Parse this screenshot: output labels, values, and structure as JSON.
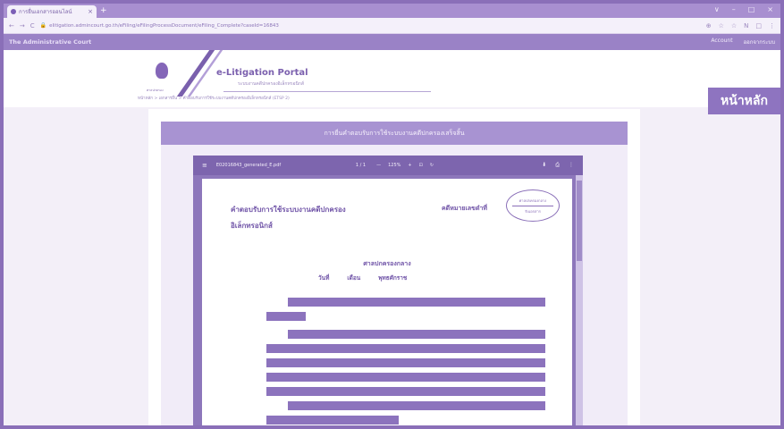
{
  "browser": {
    "tab_title": "การยื่นเอกสารออนไลน์",
    "tab_close": "×",
    "new_tab": "+",
    "window_controls": [
      "∨",
      "–",
      "□",
      "×"
    ],
    "nav": [
      "←",
      "→",
      "C"
    ],
    "url": "elitigation.admincourt.go.th/eFiling/eFilingProcessDocument/eFiling_Complete?caseId=16843",
    "tools": [
      "⊕",
      "☆",
      "☆",
      "N",
      "□",
      "⋮"
    ]
  },
  "site": {
    "brand": "The Administrative Court",
    "links": [
      "Account",
      "ออกจากระบบ"
    ],
    "emblem_label": "ศาลปกครอง",
    "portal_title": "e-Litigation Portal",
    "portal_subtitle": "ระบบงานคดีปกครองอิเล็กทรอนิกส์",
    "breadcrumb": "หน้าหลัก > เอกสารยื่น > คำตอบรับการใช้ระบบงานคดีปกครองอิเล็กทรอนิกส์ (ETSP 2)",
    "home_badge": "หน้าหลัก"
  },
  "form": {
    "header": "การยื่นคำตอบรับการใช้ระบบงานคดีปกครองเสร็จสิ้น"
  },
  "viewer": {
    "menu_icon": "≡",
    "file_name": "E02016843_generated_E.pdf",
    "pager": "1 / 1",
    "zoom": [
      "—",
      "125%",
      "+",
      "⊡",
      "↻"
    ],
    "right_icons": [
      "⬇",
      "⎙",
      "⋮"
    ]
  },
  "document": {
    "title_line1": "คำตอบรับการใช้ระบบงานคดีปกครอง",
    "title_line2": "อิเล็กทรอนิกส์",
    "case_label": "คดีหมายเลขดำที่",
    "stamp_top": "ศาลปกครองกลาง",
    "stamp_bottom": "รับเอกสาร",
    "court": "ศาลปกครองกลาง",
    "date_labels": [
      "วันที่",
      "เดือน",
      "พุทธศักราช"
    ]
  }
}
